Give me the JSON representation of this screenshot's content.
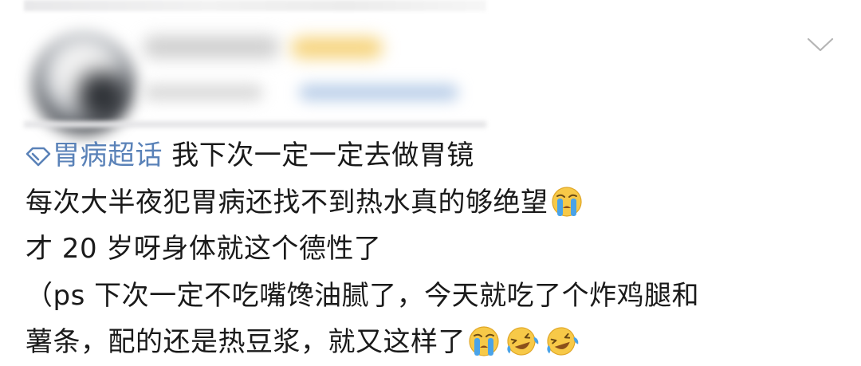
{
  "header": {
    "username_obscured": "",
    "meta_obscured": ""
  },
  "post": {
    "topic": "胃病超话",
    "line1_rest": " 我下次一定一定去做胃镜",
    "line2": "每次大半夜犯胃病还找不到热水真的够绝望",
    "line3": "才 20 岁呀身体就这个德性了",
    "line4": "（ps 下次一定不吃嘴馋油腻了，今天就吃了个炸鸡腿和",
    "line5": "薯条，配的还是热豆浆，就又这样了",
    "emojis": {
      "line2_end": "crying-emoji",
      "line5_end": [
        "crying-emoji",
        "laughing-crying-emoji",
        "laughing-crying-emoji"
      ]
    }
  },
  "colors": {
    "topic_link": "#5a82b8",
    "text": "#1a1a1a",
    "emoji_face": "#f7c948",
    "emoji_tears": "#4aa3e8"
  }
}
